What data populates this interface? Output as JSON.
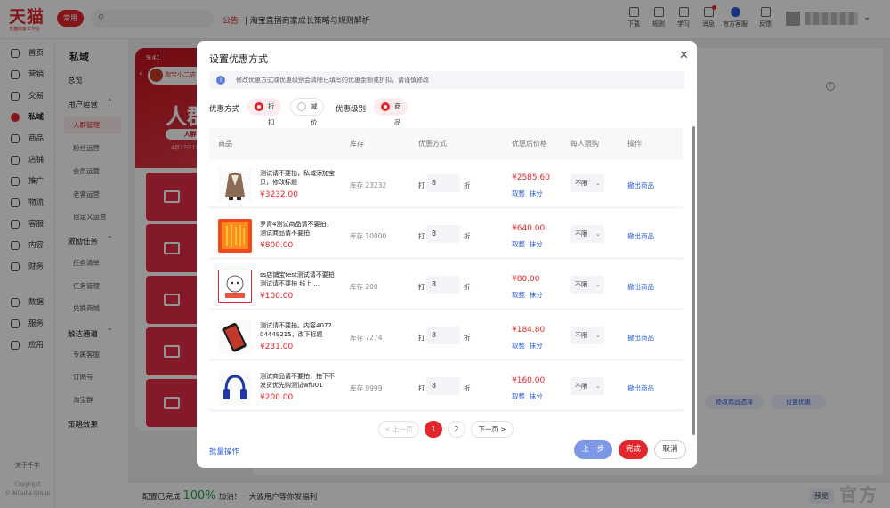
{
  "brand": {
    "name": "天猫",
    "sub": "天猫商家工作台"
  },
  "topbar": {
    "often": "常用",
    "notice_tag": "公告",
    "notice_text": "淘宝直播商家成长策略与规则解析",
    "icons": [
      {
        "label": "下载",
        "icon": "download-icon"
      },
      {
        "label": "规则",
        "icon": "rules-icon"
      },
      {
        "label": "学习",
        "icon": "learn-icon"
      },
      {
        "label": "消息",
        "icon": "message-icon"
      },
      {
        "label": "官方客服",
        "icon": "service-icon"
      },
      {
        "label": "反馈",
        "icon": "feedback-icon"
      }
    ]
  },
  "sidebar": {
    "items": [
      {
        "label": "首页",
        "icon": "home-icon"
      },
      {
        "label": "营销",
        "icon": "marketing-icon"
      },
      {
        "label": "交易",
        "icon": "trade-icon"
      },
      {
        "label": "私域",
        "icon": "private-icon",
        "active": true
      },
      {
        "label": "商品",
        "icon": "goods-icon"
      },
      {
        "label": "店铺",
        "icon": "shop-icon"
      },
      {
        "label": "推广",
        "icon": "promote-icon"
      },
      {
        "label": "物流",
        "icon": "logistics-icon"
      },
      {
        "label": "客服",
        "icon": "customer-service-icon"
      },
      {
        "label": "内容",
        "icon": "content-icon"
      },
      {
        "label": "财务",
        "icon": "finance-icon"
      },
      {
        "label": "数据",
        "icon": "data-icon"
      },
      {
        "label": "服务",
        "icon": "service-market-icon"
      },
      {
        "label": "应用",
        "icon": "apps-icon"
      }
    ],
    "about": "关于千牛",
    "copyright1": "Copyright",
    "copyright2": "© Alibaba Group"
  },
  "subnav": {
    "title": "私域",
    "overview": "总览",
    "groups": [
      {
        "label": "用户运营",
        "items": [
          "人群管理",
          "粉丝运营",
          "会员运营",
          "老客运营",
          "自定义运营"
        ]
      },
      {
        "label": "激励任务",
        "items": [
          "任务清单",
          "任务管理",
          "兑换商城"
        ]
      },
      {
        "label": "触达通道",
        "items": [
          "专属客服",
          "订阅号",
          "淘宝群"
        ]
      }
    ],
    "last": "策略效果"
  },
  "phone": {
    "time": "9:41",
    "shop": "淘宝小二店",
    "big": "人群",
    "pill": "人群1",
    "date": "4月27日13:0"
  },
  "background": {
    "btn1": "修改商品选择",
    "btn2": "设置优惠",
    "bottom_msg": "配置已完成",
    "bottom_pct": "100%",
    "bottom_msg2": "加油！一大波用户等你发福利",
    "preview": "预览",
    "watermark": "官方",
    "circle": "?"
  },
  "modal": {
    "title": "设置优惠方式",
    "tip": "修改优惠方式或优惠级别会清除已填写的优惠金额或折扣，请谨慎修改",
    "discount_label": "优惠方式",
    "discount_opts": [
      "折扣",
      "减价"
    ],
    "level_label": "优惠级别",
    "level_opts": [
      "商品"
    ],
    "columns": [
      "商品",
      "库存",
      "优惠方式",
      "优惠后价格",
      "每人限购",
      "操作"
    ],
    "rows": [
      {
        "name": "测试请不要拍，私域添加宝贝，修改标题",
        "price": "¥3232.00",
        "stock": "库存 23232",
        "discount": "8",
        "after": "¥2585.60",
        "limit": "不限",
        "img": "jacket"
      },
      {
        "name": "罗青4测试商品请不要拍，测试商品请不要拍",
        "price": "¥800.00",
        "stock": "库存 10000",
        "discount": "8",
        "after": "¥640.00",
        "limit": "不限",
        "img": "orange"
      },
      {
        "name": "ss店铺宝test测试请不要拍 测试请不要拍 线上 ...",
        "price": "¥100.00",
        "stock": "库存 200",
        "discount": "8",
        "after": "¥80.00",
        "limit": "不限",
        "img": "cartoon"
      },
      {
        "name": "测试请不要拍。内容4072 04449215，改下标题",
        "price": "¥231.00",
        "stock": "库存 7274",
        "discount": "8",
        "after": "¥184.80",
        "limit": "不限",
        "img": "phone"
      },
      {
        "name": "测试商品请不要拍，拍下不发货优先购测试wf001",
        "price": "¥200.00",
        "stock": "库存 9999",
        "discount": "8",
        "after": "¥160.00",
        "limit": "不限",
        "img": "headphones"
      }
    ],
    "row_da": "打",
    "row_zhe": "折",
    "round_label": "取整",
    "wipe_label": "抹分",
    "remove_label": "撤出商品",
    "pagination": {
      "prev": "< 上一页",
      "pages": [
        "1",
        "2"
      ],
      "next": "下一页 >"
    },
    "batch": "批量操作",
    "prev_step": "上一步",
    "finish": "完成",
    "cancel": "取消"
  }
}
